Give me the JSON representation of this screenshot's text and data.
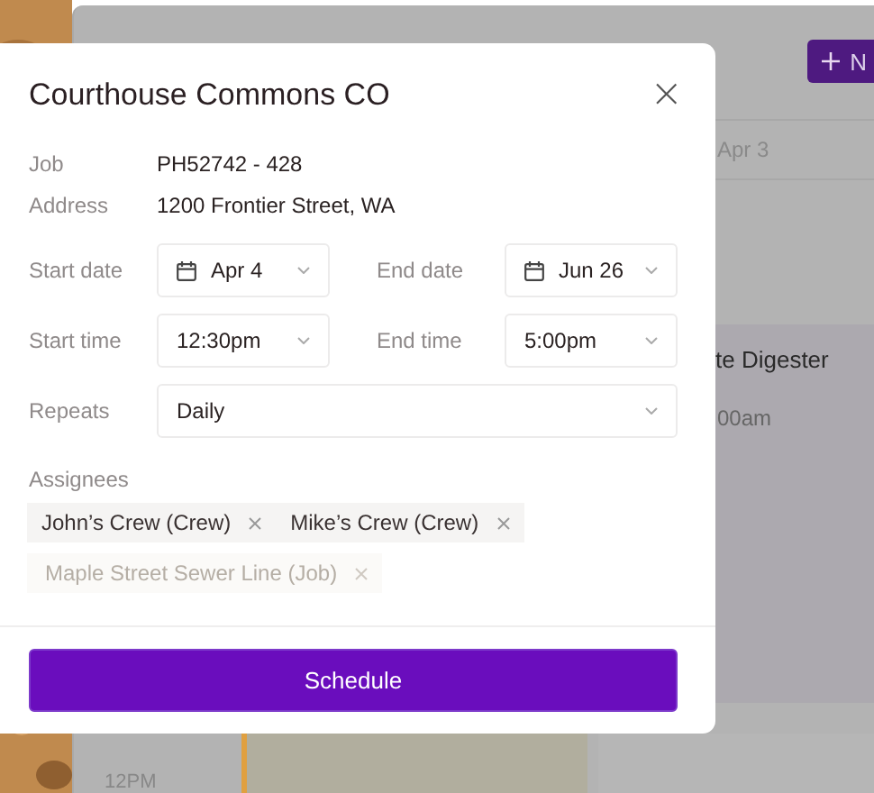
{
  "background": {
    "new_button": "N",
    "day_label": "Apr 3",
    "event_title": "te Digester",
    "event_time": "00am",
    "hour_label": "12PM"
  },
  "dialog": {
    "title": "Courthouse Commons CO",
    "close": "×",
    "details": [
      {
        "label": "Job",
        "value": "PH52742 - 428"
      },
      {
        "label": "Address",
        "value": "1200 Frontier Street, WA"
      }
    ],
    "start_date": {
      "label": "Start date",
      "value": "Apr 4"
    },
    "end_date": {
      "label": "End date",
      "value": "Jun 26"
    },
    "start_time": {
      "label": "Start time",
      "value": "12:30pm"
    },
    "end_time": {
      "label": "End time",
      "value": "5:00pm"
    },
    "repeats": {
      "label": "Repeats",
      "value": "Daily"
    },
    "assignees_label": "Assignees",
    "assignees": [
      {
        "label": "John’s Crew (Crew)",
        "faded": false
      },
      {
        "label": "Mike’s Crew (Crew)",
        "faded": false
      },
      {
        "label": "Maple Street Sewer Line (Job)",
        "faded": true
      }
    ],
    "submit": "Schedule"
  }
}
